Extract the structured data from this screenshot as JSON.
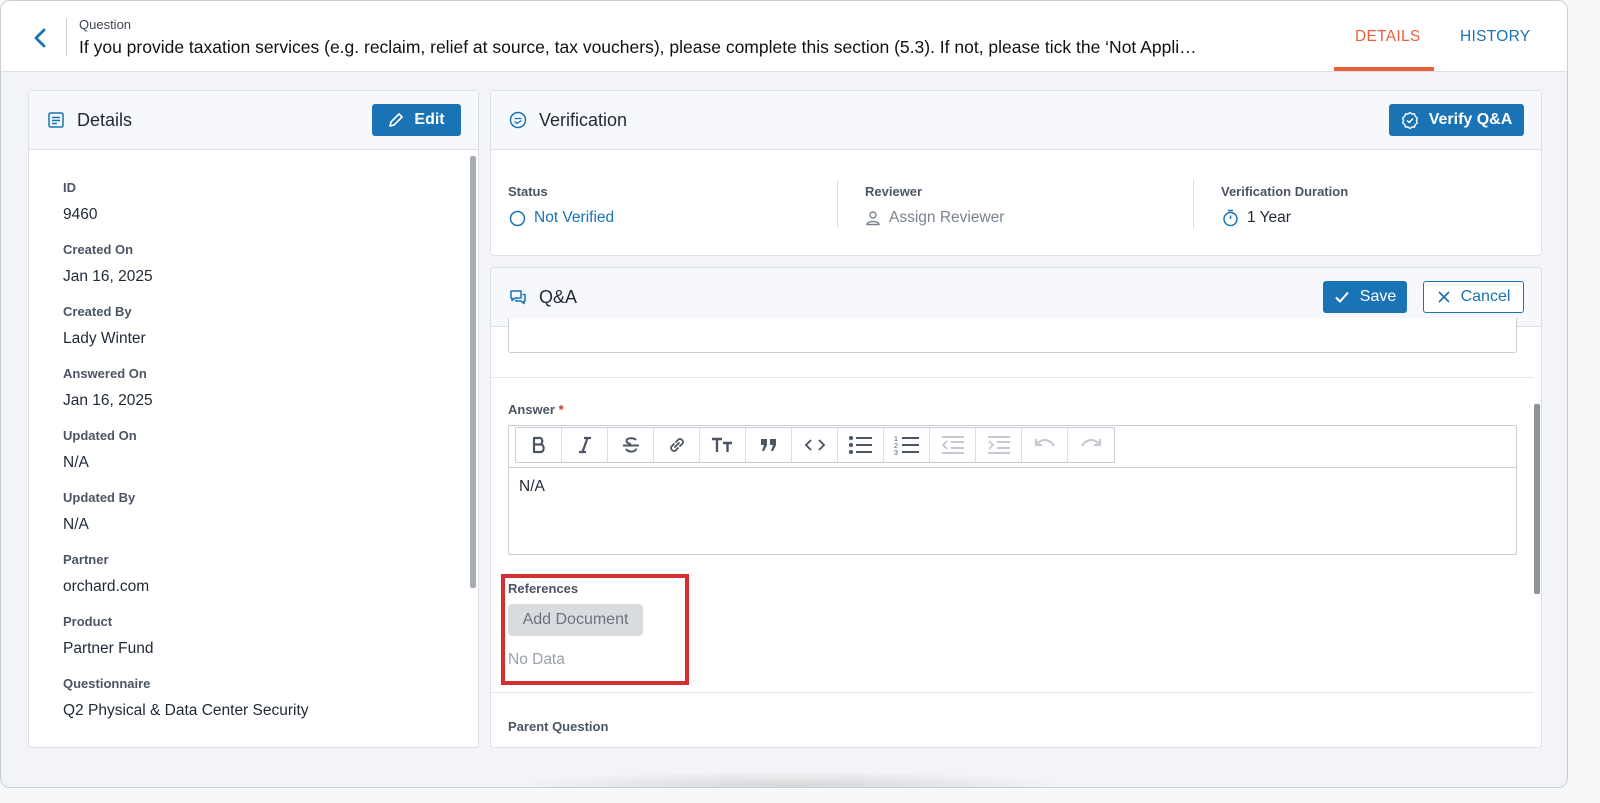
{
  "header": {
    "question_label": "Question",
    "question_text": "If you provide taxation services (e.g. reclaim, relief at source, tax vouchers), please complete this section (5.3). If not, please tick the ‘Not Appli…",
    "tabs": [
      {
        "label": "DETAILS",
        "active": true
      },
      {
        "label": "HISTORY",
        "active": false
      }
    ]
  },
  "details": {
    "title": "Details",
    "edit_label": "Edit",
    "fields": [
      {
        "label": "ID",
        "value": "9460"
      },
      {
        "label": "Created On",
        "value": "Jan 16, 2025"
      },
      {
        "label": "Created By",
        "value": "Lady Winter"
      },
      {
        "label": "Answered On",
        "value": "Jan 16, 2025"
      },
      {
        "label": "Updated On",
        "value": "N/A"
      },
      {
        "label": "Updated By",
        "value": "N/A"
      },
      {
        "label": "Partner",
        "value": "orchard.com"
      },
      {
        "label": "Product",
        "value": "Partner Fund"
      },
      {
        "label": "Questionnaire",
        "value": "Q2 Physical & Data Center Security"
      }
    ]
  },
  "verification": {
    "title": "Verification",
    "verify_label": "Verify Q&A",
    "status_label": "Status",
    "status_value": "Not Verified",
    "reviewer_label": "Reviewer",
    "reviewer_value": "Assign Reviewer",
    "duration_label": "Verification Duration",
    "duration_value": "1 Year"
  },
  "qa": {
    "title": "Q&A",
    "save_label": "Save",
    "cancel_label": "Cancel",
    "answer_label": "Answer",
    "required_mark": "*",
    "answer_text": "N/A",
    "references_label": "References",
    "add_document_label": "Add Document",
    "no_data": "No Data",
    "parent_question_label": "Parent Question"
  },
  "colors": {
    "accent": "#1a73b5",
    "active_tab": "#e8603c",
    "highlight": "#d62f2f"
  }
}
